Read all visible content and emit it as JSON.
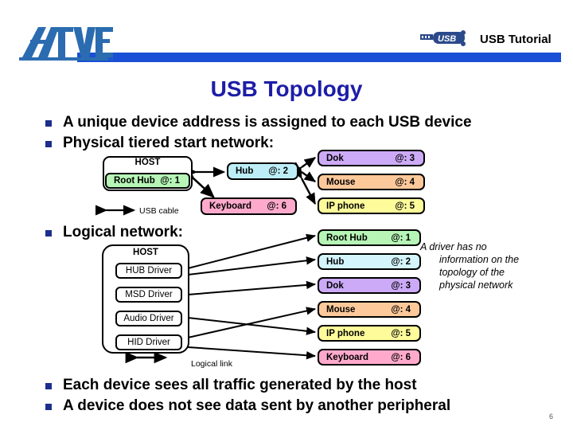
{
  "header": {
    "logo_alt": "ATMEL",
    "usb_logo_alt": "USB",
    "title": "USB Tutorial",
    "bar_color": "#1a4fd6"
  },
  "slide": {
    "title": "USB Topology",
    "title_color": "#1d1da8",
    "page_number": "6"
  },
  "bullets": [
    {
      "text": "A unique device address is assigned to each USB device"
    },
    {
      "text": "Physical tiered start network:"
    },
    {
      "text": "Logical network:"
    },
    {
      "text": "Each device sees all traffic generated by the host"
    },
    {
      "text": "A device does not see data sent by another peripheral"
    }
  ],
  "physical": {
    "host_label": "HOST",
    "legend": "USB cable",
    "root_hub": {
      "name": "Root Hub",
      "addr": "@: 1",
      "color": "#b6f5b6"
    },
    "hub": {
      "name": "Hub",
      "addr": "@: 2",
      "color": "#bdeef7"
    },
    "keyboard": {
      "name": "Keyboard",
      "addr": "@: 6",
      "color": "#ffaacc"
    },
    "devices": [
      {
        "name": "Dok",
        "addr": "@: 3",
        "color": "#ccaaf7"
      },
      {
        "name": "Mouse",
        "addr": "@: 4",
        "color": "#fdc99a"
      },
      {
        "name": "IP phone",
        "addr": "@: 5",
        "color": "#fdfb9a"
      }
    ]
  },
  "logical": {
    "host_label": "HOST",
    "legend": "Logical link",
    "drivers": [
      {
        "label": "HUB Driver"
      },
      {
        "label": "MSD Driver"
      },
      {
        "label": "Audio Driver"
      },
      {
        "label": "HID Driver"
      }
    ],
    "devices": [
      {
        "name": "Root Hub",
        "addr": "@: 1",
        "color": "#b6f5b6"
      },
      {
        "name": "Hub",
        "addr": "@: 2",
        "color": "#d3f5fb"
      },
      {
        "name": "Dok",
        "addr": "@: 3",
        "color": "#ccaaf7"
      },
      {
        "name": "Mouse",
        "addr": "@: 4",
        "color": "#fdc99a"
      },
      {
        "name": "IP phone",
        "addr": "@: 5",
        "color": "#fdfb9a"
      },
      {
        "name": "Keyboard",
        "addr": "@: 6",
        "color": "#ffaacc"
      }
    ],
    "note_line1": "A driver has no",
    "note_line2": "information on the",
    "note_line3": "topology of the",
    "note_line4": "physical network"
  }
}
